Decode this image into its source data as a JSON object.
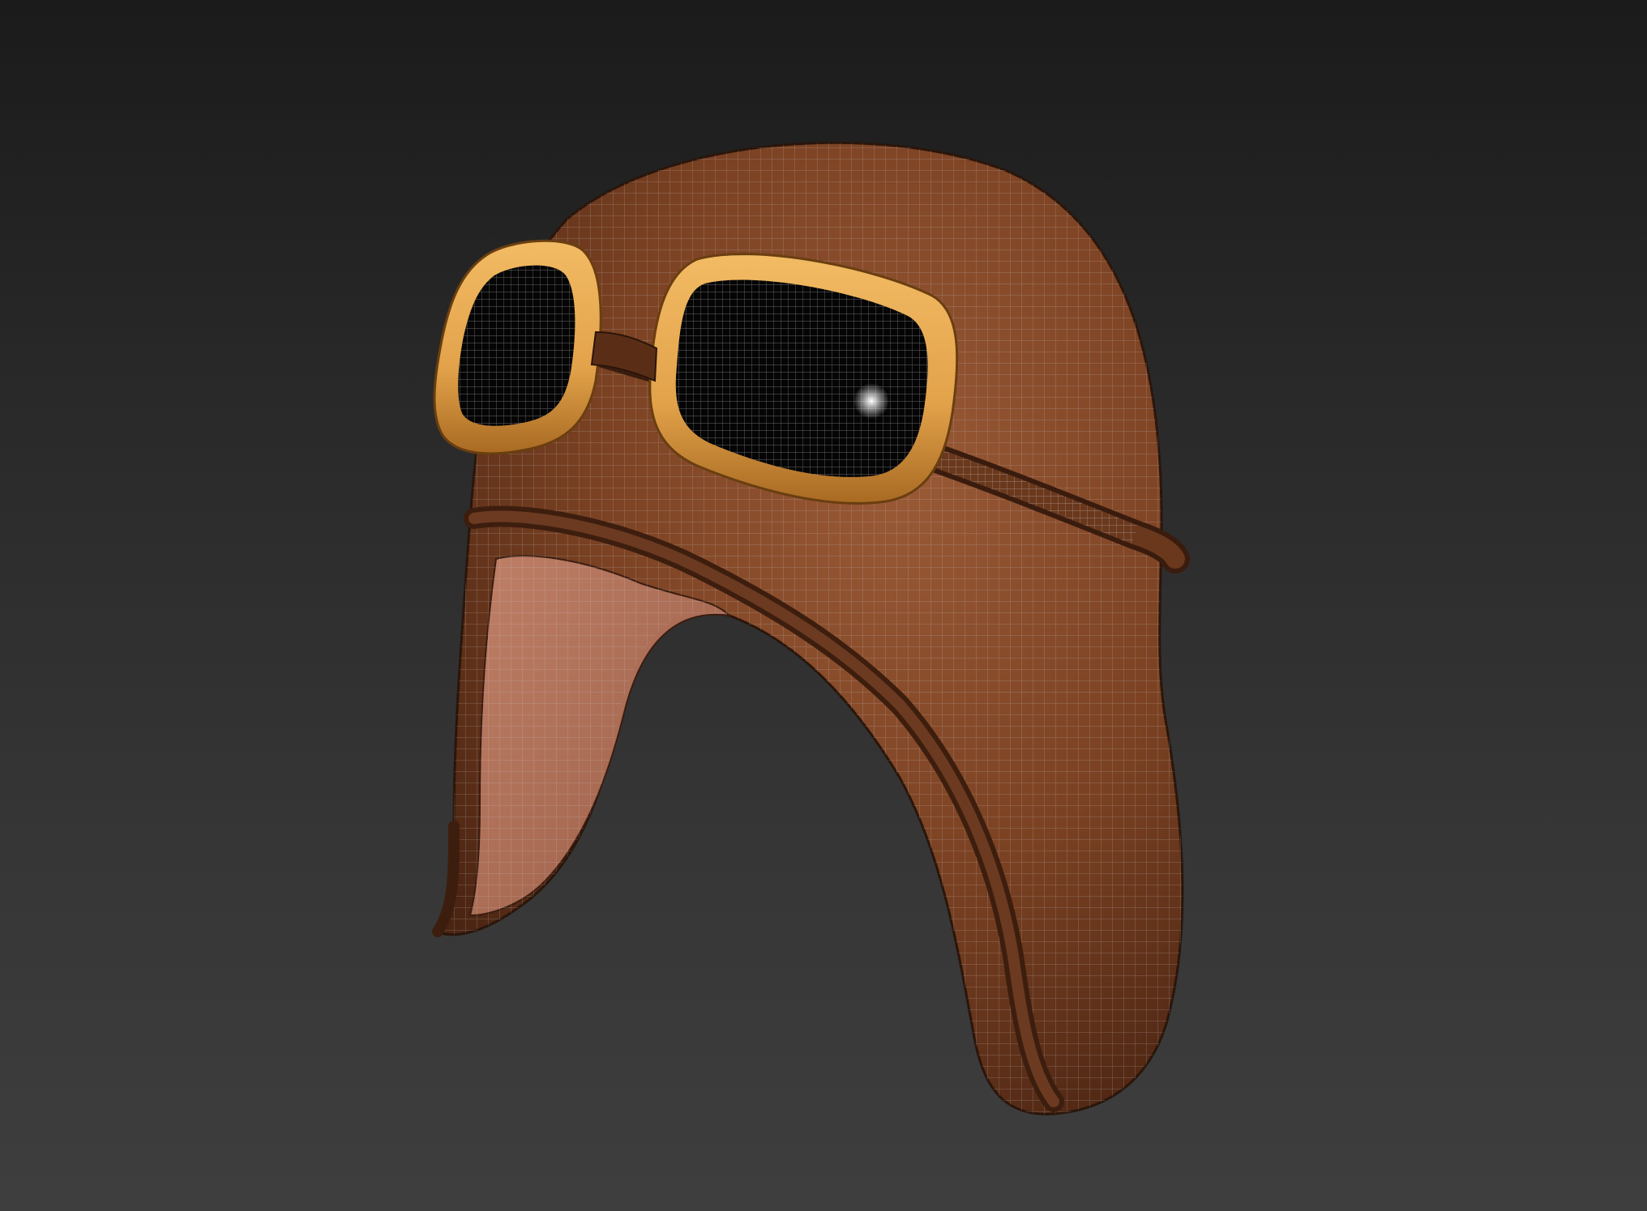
{
  "viewport": {
    "background_top": "#1b1b1b",
    "background_bottom": "#3e3e3e"
  },
  "model": {
    "subject": "leather-aviator-helmet-with-goggles",
    "display_mode": "shaded-with-wireframe",
    "colors": {
      "leather": "#7a4122",
      "leather_dark": "#4a2412",
      "leather_highlight": "#9a5a36",
      "inner_lining": "#a86a52",
      "goggle_frame": "#e2a24a",
      "goggle_frame_dark": "#a86a22",
      "lens": "#050505",
      "wireframe": "#c8c8d0"
    }
  }
}
